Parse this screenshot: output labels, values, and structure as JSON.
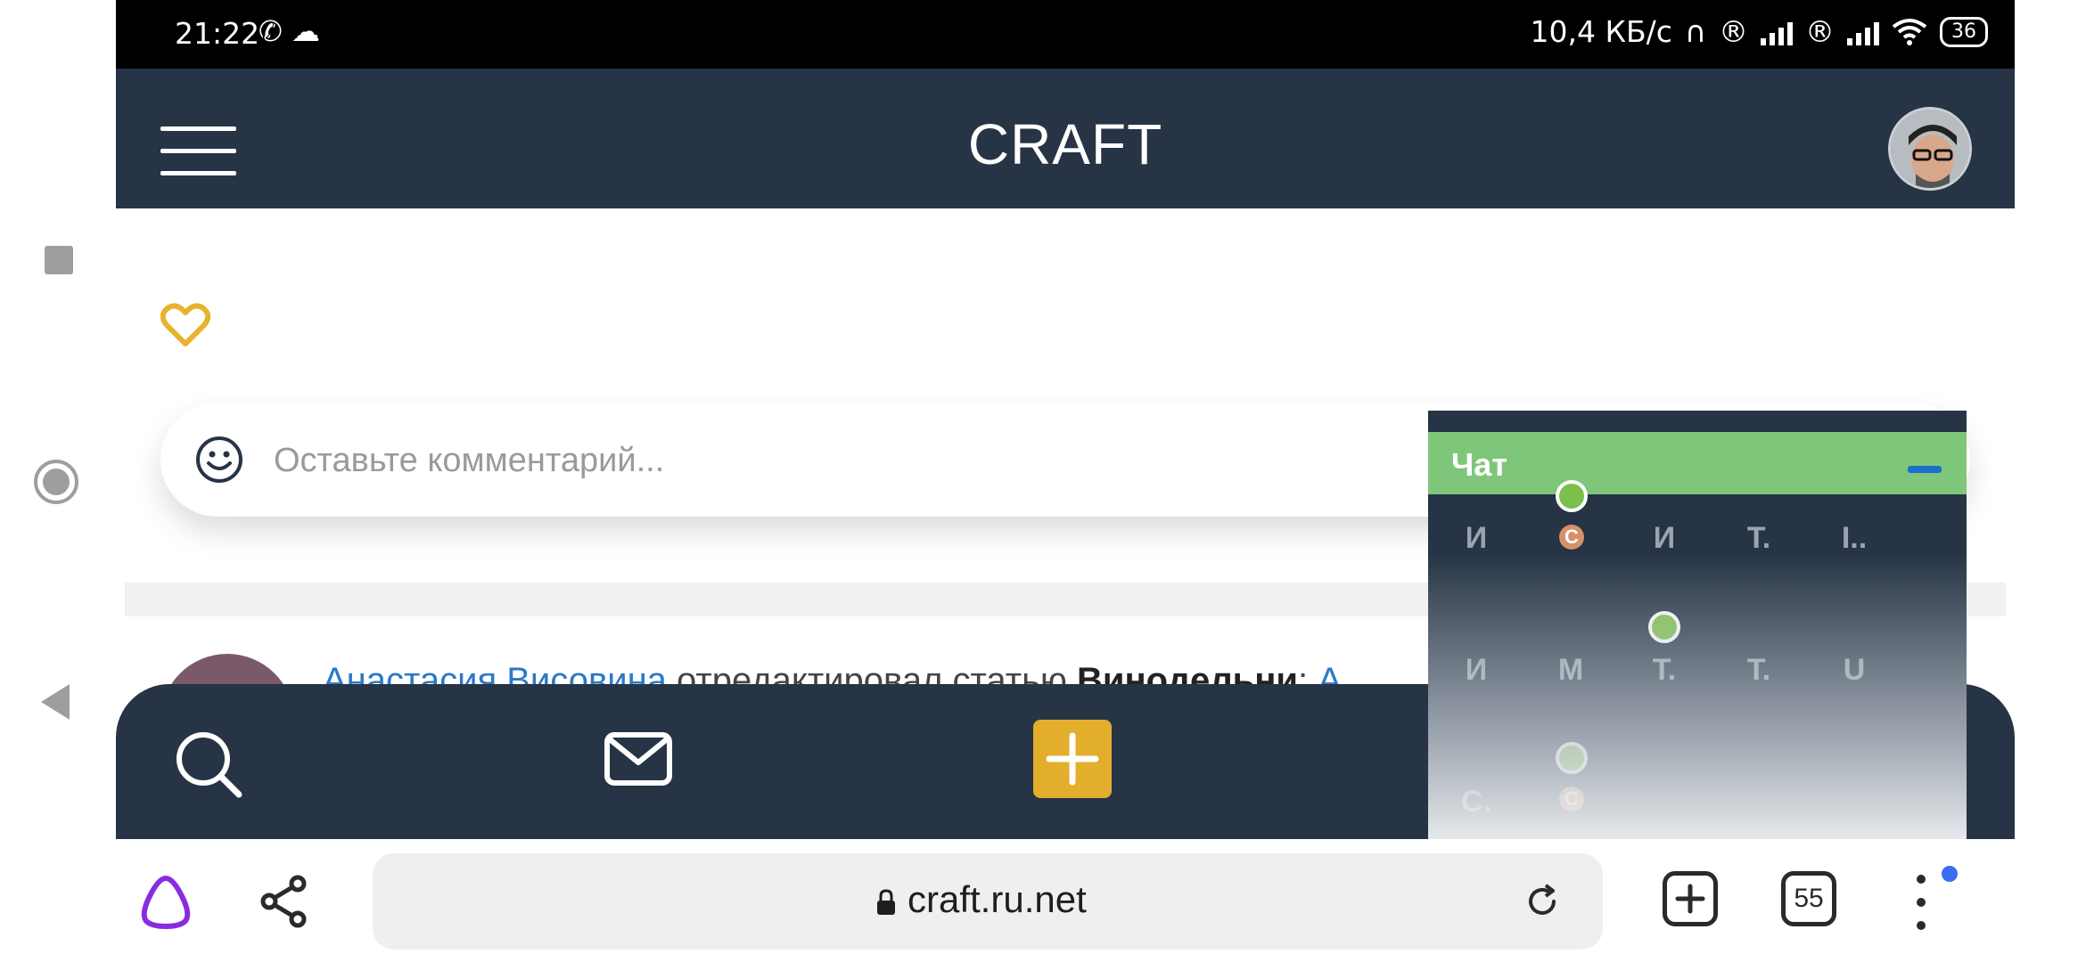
{
  "status_bar": {
    "time": "21:22",
    "network_speed": "10,4 КБ/с",
    "battery": "36",
    "icons": [
      "call-icon",
      "cloud-icon",
      "headphones-icon",
      "roaming-icon",
      "signal-icon",
      "wifi-icon",
      "battery-icon"
    ]
  },
  "header": {
    "title": "CRAFT"
  },
  "comment": {
    "placeholder": "Оставьте комментарий..."
  },
  "feed": {
    "user": "Анастасия Висовина",
    "action": " отредактировал статью ",
    "article": "Винодельни",
    "separator": ": ",
    "link": "А"
  },
  "chat": {
    "title": "Чат",
    "users": [
      {
        "label": "И"
      },
      {
        "label": "И"
      },
      {
        "label": "Т."
      },
      {
        "label": "I.."
      },
      {
        "label": "И"
      },
      {
        "label": "М"
      },
      {
        "label": "Т."
      },
      {
        "label": "Т."
      },
      {
        "label": "U"
      },
      {
        "label": "С."
      }
    ],
    "avatar_letter": "С"
  },
  "browser": {
    "url": "craft.ru.net",
    "tab_count": "55"
  },
  "colors": {
    "header_bg": "#263445",
    "chat_header": "#7ec67a",
    "accent_yellow": "#e2ae2c",
    "link_blue": "#2c78c7"
  }
}
